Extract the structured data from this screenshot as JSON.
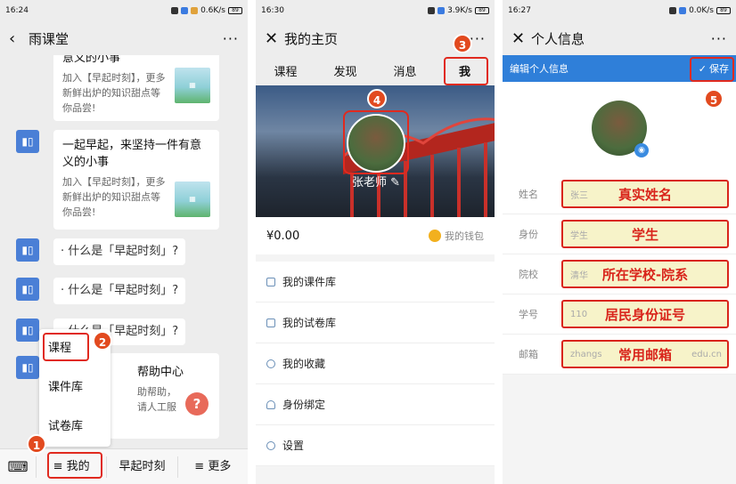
{
  "colors": {
    "accent": "#2f7fd9",
    "annotation": "#e02a1f",
    "badge": "#e24a1f",
    "field_bg": "#f7f3c9"
  },
  "phone1": {
    "status": {
      "time": "16:24",
      "speed": "0.6K/s",
      "battery": "89"
    },
    "title": "雨课堂",
    "more": "···",
    "cards": [
      {
        "title": "意义的小事",
        "desc": "加入【早起时刻】，更多新鲜出炉的知识甜点等你品尝!"
      },
      {
        "title": "一起早起，来坚持一件有意义的小事",
        "desc": "加入【早起时刻】，更多新鲜出炉的知识甜点等你品尝!"
      }
    ],
    "bubbles": [
      "· 什么是「早起时刻」?",
      "· 什么是「早起时刻」?",
      "· 什么是「早起时刻」?"
    ],
    "popup": [
      "课程",
      "课件库",
      "试卷库"
    ],
    "help": {
      "title": "帮助中心",
      "desc": "助帮助，请人工服"
    },
    "bottombar": [
      "≡ 我的",
      "早起时刻",
      "≡ 更多"
    ]
  },
  "phone2": {
    "status": {
      "time": "16:30",
      "speed": "3.9K/s",
      "battery": "89"
    },
    "title": "我的主页",
    "tabs": [
      "课程",
      "发现",
      "消息",
      "我"
    ],
    "name": "张老师",
    "balance": "¥0.00",
    "wallet": "我的钱包",
    "menu": [
      "我的课件库",
      "我的试卷库",
      "我的收藏",
      "身份绑定",
      "设置"
    ]
  },
  "phone3": {
    "status": {
      "time": "16:27",
      "speed": "0.0K/s",
      "battery": "89"
    },
    "title": "个人信息",
    "edit_label": "编辑个人信息",
    "save": "保存",
    "rows": [
      {
        "label": "姓名",
        "placeholder": "张三",
        "value": "真实姓名",
        "suffix": ""
      },
      {
        "label": "身份",
        "placeholder": "学生",
        "value": "学生",
        "suffix": ""
      },
      {
        "label": "院校",
        "placeholder": "清华",
        "value": "所在学校-院系",
        "suffix": ""
      },
      {
        "label": "学号",
        "placeholder": "110",
        "value": "居民身份证号",
        "suffix": ""
      },
      {
        "label": "邮箱",
        "placeholder": "zhangs",
        "value": "常用邮箱",
        "suffix": "edu.cn"
      }
    ]
  },
  "badges": [
    "1",
    "2",
    "3",
    "4",
    "5"
  ]
}
